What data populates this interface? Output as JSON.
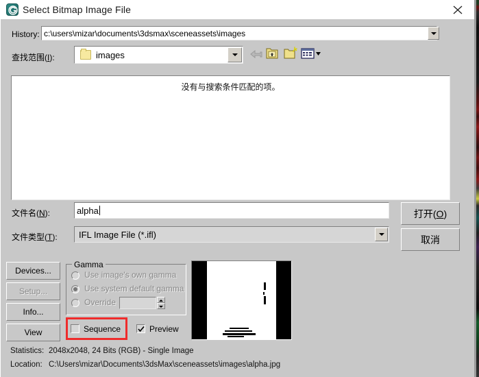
{
  "window": {
    "title": "Select Bitmap Image File",
    "icon": "3dsmax-app-icon",
    "close_label": "close-icon"
  },
  "history": {
    "label": "History:",
    "value": "c:\\users\\mizar\\documents\\3dsmax\\sceneassets\\images",
    "dropdown_icon": "chevron-down-icon"
  },
  "lookin": {
    "label_prefix": "查找范围(",
    "label_accel": "I",
    "label_suffix": "):",
    "value": "images",
    "folder_icon": "folder-icon",
    "dropdown_icon": "chevron-down-icon"
  },
  "toolbar": {
    "back": "back-arrow-icon",
    "up": "up-one-level-icon",
    "new_folder": "new-folder-icon",
    "views": "views-menu-icon",
    "views_arrow": "chevron-down-icon"
  },
  "listview": {
    "empty_message": "没有与搜索条件匹配的项。"
  },
  "filename": {
    "label_prefix": "文件名(",
    "label_accel": "N",
    "label_suffix": "):",
    "value": "alpha"
  },
  "filetype": {
    "label_prefix": "文件类型(",
    "label_accel": "T",
    "label_suffix": "):",
    "value": "IFL Image File (*.ifl)",
    "dropdown_icon": "chevron-down-icon"
  },
  "actions": {
    "open_prefix": "打开(",
    "open_accel": "O",
    "open_suffix": ")",
    "cancel": "取消"
  },
  "side_buttons": [
    {
      "label": "Devices...",
      "name": "devices-button",
      "disabled": false
    },
    {
      "label": "Setup...",
      "name": "setup-button",
      "disabled": true
    },
    {
      "label": "Info...",
      "name": "info-button",
      "disabled": false
    },
    {
      "label": "View",
      "name": "view-button",
      "disabled": false
    }
  ],
  "gamma": {
    "title": "Gamma",
    "options": [
      {
        "label": "Use image's own gamma",
        "checked": false
      },
      {
        "label": "Use system default gamma",
        "checked": true
      },
      {
        "label": "Override",
        "checked": false
      }
    ],
    "override_value": ""
  },
  "checkboxes": {
    "sequence": {
      "label": "Sequence",
      "checked": false,
      "highlighted": true
    },
    "preview": {
      "label": "Preview",
      "checked": true,
      "highlighted": false
    }
  },
  "status": {
    "statistics_key": "Statistics:",
    "statistics_value": "2048x2048, 24 Bits (RGB) - Single Image",
    "location_key": "Location:",
    "location_value": "C:\\Users\\mizar\\Documents\\3dsMax\\sceneassets\\images\\alpha.jpg"
  },
  "colors": {
    "dialog_face": "#c8c8c8",
    "field_bg": "#ffffff",
    "annotation_red": "#ef2b2b",
    "folder_yellow": "#f7e9a0",
    "title_icon_teal": "#2e8b86"
  }
}
